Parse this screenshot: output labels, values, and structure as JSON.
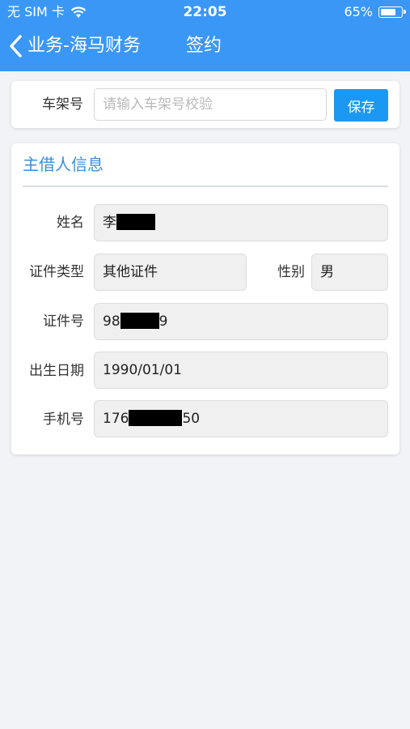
{
  "status_bar": {
    "carrier": "无 SIM 卡",
    "time": "22:05",
    "battery_percent": "65%",
    "battery_level": 0.65,
    "wifi_icon": "wifi-icon",
    "battery_icon": "battery-icon"
  },
  "nav": {
    "back_label": "业务-海马财务",
    "title": "签约",
    "back_icon": "chevron-left-icon"
  },
  "vin_section": {
    "label": "车架号",
    "placeholder": "请输入车架号校验",
    "value": "",
    "save_label": "保存"
  },
  "borrower": {
    "title": "主借人信息",
    "name_label": "姓名",
    "name_prefix": "李",
    "id_type_label": "证件类型",
    "id_type_value": "其他证件",
    "gender_label": "性别",
    "gender_value": "男",
    "id_number_label": "证件号",
    "id_number_prefix": "98",
    "id_number_suffix": "9",
    "birth_label": "出生日期",
    "birth_value": "1990/01/01",
    "phone_label": "手机号",
    "phone_prefix": "176",
    "phone_suffix": "50"
  },
  "colors": {
    "header_bg": "#3a97f5",
    "save_button_bg": "#1a98f2",
    "section_title": "#3a8fdc",
    "page_bg": "#f1f3f6"
  }
}
